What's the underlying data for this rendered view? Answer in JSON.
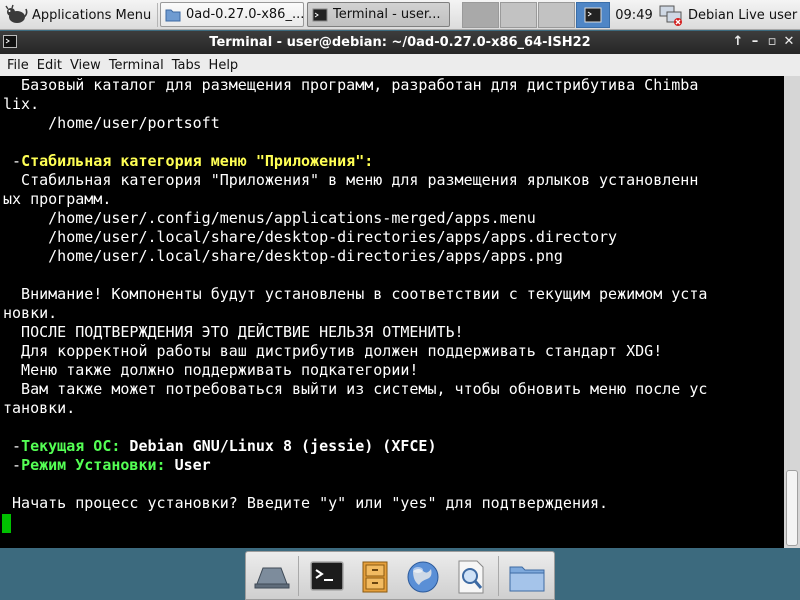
{
  "panel": {
    "apps_menu_label": "Applications Menu",
    "tasks": [
      {
        "label": "0ad-0.27.0-x86_...",
        "icon": "folder-icon"
      },
      {
        "label": "Terminal - user...",
        "icon": "terminal-icon"
      }
    ],
    "clock": "09:49",
    "user_label": "Debian Live user"
  },
  "window": {
    "title": "Terminal - user@debian: ~/0ad-0.27.0-x86_64-ISH22"
  },
  "menubar": {
    "file": "File",
    "edit": "Edit",
    "view": "View",
    "terminal": "Terminal",
    "tabs": "Tabs",
    "help": "Help"
  },
  "terminal": {
    "l01": "  Базовый каталог для размещения программ, разработан для дистрибутива Chimba",
    "l02": "lix.",
    "l03": "     /home/user/portsoft",
    "l05a": " -",
    "l05b": "Стабильная категория меню \"Приложения\":",
    "l06": "  Стабильная категория \"Приложения\" в меню для размещения ярлыков установленн",
    "l07": "ых программ.",
    "l08": "     /home/user/.config/menus/applications-merged/apps.menu",
    "l09": "     /home/user/.local/share/desktop-directories/apps/apps.directory",
    "l10": "     /home/user/.local/share/desktop-directories/apps/apps.png",
    "l12": "  Внимание! Компоненты будут установлены в соответствии с текущим режимом уста",
    "l13": "новки.",
    "l14": "  ПОСЛЕ ПОДТВЕРЖДЕНИЯ ЭТО ДЕЙСТВИЕ НЕЛЬЗЯ ОТМЕНИТЬ!",
    "l15": "  Для корректной работы ваш дистрибутив должен поддерживать стандарт XDG!",
    "l16": "  Меню также должно поддерживать подкатегории!",
    "l17": "  Вам также может потребоваться выйти из системы, чтобы обновить меню после ус",
    "l18": "тановки.",
    "l20a": " -",
    "l20b": "Текущая ОС:",
    "l20c": " Debian GNU/Linux 8 (jessie) (XFCE)",
    "l21a": " -",
    "l21b": "Режим Установки:",
    "l21c": " User",
    "l23": " Начать процесс установки? Введите \"y\" или \"yes\" для подтверждения."
  },
  "colors": {
    "accent_yellow": "#ffff54",
    "accent_green": "#54ff54",
    "cursor": "#00c000",
    "desktop": "#3c6a7e"
  },
  "dock_icons": [
    "desktop-icon",
    "terminal-icon",
    "file-cabinet-icon",
    "web-browser-icon",
    "app-finder-icon",
    "folder-icon"
  ]
}
